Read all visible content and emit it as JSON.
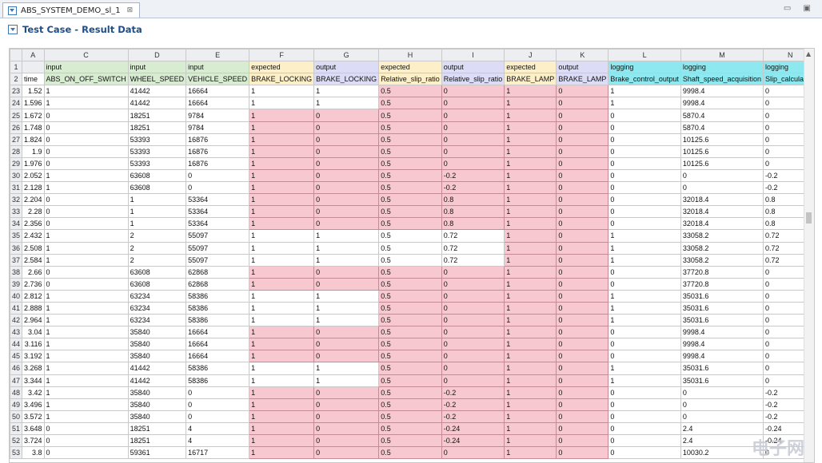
{
  "tab": {
    "title": "ABS_SYSTEM_DEMO_sl_1",
    "close": "⊠"
  },
  "window_controls": "▭ ▣",
  "header": {
    "title": "Test Case - Result Data"
  },
  "columns": [
    "A",
    "C",
    "D",
    "E",
    "F",
    "G",
    "H",
    "I",
    "J",
    "K",
    "L",
    "M",
    "N"
  ],
  "col_widths": [
    40,
    77,
    77,
    77,
    77,
    77,
    77,
    77,
    77,
    77,
    77,
    77,
    77,
    56
  ],
  "row1": [
    "",
    "input",
    "input",
    "input",
    "expected",
    "output",
    "expected",
    "output",
    "expected",
    "output",
    "logging",
    "logging",
    "logging"
  ],
  "row2": [
    "time",
    "ABS_ON_OFF_SWITCH",
    "WHEEL_SPEED",
    "VEHICLE_SPEED",
    "BRAKE_LOCKING",
    "BRAKE_LOCKING",
    "Relative_slip_ratio",
    "Relative_slip_ratio",
    "BRAKE_LAMP",
    "BRAKE_LAMP",
    "Brake_control_output",
    "Shaft_speed_acquisition",
    "Slip_calculation"
  ],
  "row1_colors": [
    "#ffffff",
    "#d7ecd1",
    "#d7ecd1",
    "#d7ecd1",
    "#fdf0c9",
    "#dcdcf6",
    "#fdf0c9",
    "#dcdcf6",
    "#fdf0c9",
    "#dcdcf6",
    "#8de9ef",
    "#8de9ef",
    "#8de9ef"
  ],
  "rows": [
    {
      "n": "23",
      "v": [
        "1.52",
        "1",
        "41442",
        "16664",
        "1",
        "1",
        "0.5",
        "0",
        "1",
        "0",
        "1",
        "9998.4",
        "0"
      ],
      "p": [
        0,
        0,
        0,
        0,
        0,
        0,
        1,
        1,
        1,
        1,
        0,
        0,
        0
      ]
    },
    {
      "n": "24",
      "v": [
        "1.596",
        "1",
        "41442",
        "16664",
        "1",
        "1",
        "0.5",
        "0",
        "1",
        "0",
        "1",
        "9998.4",
        "0"
      ],
      "p": [
        0,
        0,
        0,
        0,
        0,
        0,
        1,
        1,
        1,
        1,
        0,
        0,
        0
      ]
    },
    {
      "n": "25",
      "v": [
        "1.672",
        "0",
        "18251",
        "9784",
        "1",
        "0",
        "0.5",
        "0",
        "1",
        "0",
        "0",
        "5870.4",
        "0"
      ],
      "p": [
        0,
        0,
        0,
        0,
        1,
        1,
        1,
        1,
        1,
        1,
        0,
        0,
        0
      ]
    },
    {
      "n": "26",
      "v": [
        "1.748",
        "0",
        "18251",
        "9784",
        "1",
        "0",
        "0.5",
        "0",
        "1",
        "0",
        "0",
        "5870.4",
        "0"
      ],
      "p": [
        0,
        0,
        0,
        0,
        1,
        1,
        1,
        1,
        1,
        1,
        0,
        0,
        0
      ]
    },
    {
      "n": "27",
      "v": [
        "1.824",
        "0",
        "53393",
        "16876",
        "1",
        "0",
        "0.5",
        "0",
        "1",
        "0",
        "0",
        "10125.6",
        "0"
      ],
      "p": [
        0,
        0,
        0,
        0,
        1,
        1,
        1,
        1,
        1,
        1,
        0,
        0,
        0
      ]
    },
    {
      "n": "28",
      "v": [
        "1.9",
        "0",
        "53393",
        "16876",
        "1",
        "0",
        "0.5",
        "0",
        "1",
        "0",
        "0",
        "10125.6",
        "0"
      ],
      "p": [
        0,
        0,
        0,
        0,
        1,
        1,
        1,
        1,
        1,
        1,
        0,
        0,
        0
      ]
    },
    {
      "n": "29",
      "v": [
        "1.976",
        "0",
        "53393",
        "16876",
        "1",
        "0",
        "0.5",
        "0",
        "1",
        "0",
        "0",
        "10125.6",
        "0"
      ],
      "p": [
        0,
        0,
        0,
        0,
        1,
        1,
        1,
        1,
        1,
        1,
        0,
        0,
        0
      ]
    },
    {
      "n": "30",
      "v": [
        "2.052",
        "1",
        "63608",
        "0",
        "1",
        "0",
        "0.5",
        "-0.2",
        "1",
        "0",
        "0",
        "0",
        "-0.2"
      ],
      "p": [
        0,
        0,
        0,
        0,
        1,
        1,
        1,
        1,
        1,
        1,
        0,
        0,
        0
      ]
    },
    {
      "n": "31",
      "v": [
        "2.128",
        "1",
        "63608",
        "0",
        "1",
        "0",
        "0.5",
        "-0.2",
        "1",
        "0",
        "0",
        "0",
        "-0.2"
      ],
      "p": [
        0,
        0,
        0,
        0,
        1,
        1,
        1,
        1,
        1,
        1,
        0,
        0,
        0
      ]
    },
    {
      "n": "32",
      "v": [
        "2.204",
        "0",
        "1",
        "53364",
        "1",
        "0",
        "0.5",
        "0.8",
        "1",
        "0",
        "0",
        "32018.4",
        "0.8"
      ],
      "p": [
        0,
        0,
        0,
        0,
        1,
        1,
        1,
        1,
        1,
        1,
        0,
        0,
        0
      ]
    },
    {
      "n": "33",
      "v": [
        "2.28",
        "0",
        "1",
        "53364",
        "1",
        "0",
        "0.5",
        "0.8",
        "1",
        "0",
        "0",
        "32018.4",
        "0.8"
      ],
      "p": [
        0,
        0,
        0,
        0,
        1,
        1,
        1,
        1,
        1,
        1,
        0,
        0,
        0
      ]
    },
    {
      "n": "34",
      "v": [
        "2.356",
        "0",
        "1",
        "53364",
        "1",
        "0",
        "0.5",
        "0.8",
        "1",
        "0",
        "0",
        "32018.4",
        "0.8"
      ],
      "p": [
        0,
        0,
        0,
        0,
        1,
        1,
        1,
        1,
        1,
        1,
        0,
        0,
        0
      ]
    },
    {
      "n": "35",
      "v": [
        "2.432",
        "1",
        "2",
        "55097",
        "1",
        "1",
        "0.5",
        "0.72",
        "1",
        "0",
        "1",
        "33058.2",
        "0.72"
      ],
      "p": [
        0,
        0,
        0,
        0,
        0,
        0,
        0,
        0,
        1,
        1,
        0,
        0,
        0
      ]
    },
    {
      "n": "36",
      "v": [
        "2.508",
        "1",
        "2",
        "55097",
        "1",
        "1",
        "0.5",
        "0.72",
        "1",
        "0",
        "1",
        "33058.2",
        "0.72"
      ],
      "p": [
        0,
        0,
        0,
        0,
        0,
        0,
        0,
        0,
        1,
        1,
        0,
        0,
        0
      ]
    },
    {
      "n": "37",
      "v": [
        "2.584",
        "1",
        "2",
        "55097",
        "1",
        "1",
        "0.5",
        "0.72",
        "1",
        "0",
        "1",
        "33058.2",
        "0.72"
      ],
      "p": [
        0,
        0,
        0,
        0,
        0,
        0,
        0,
        0,
        1,
        1,
        0,
        0,
        0
      ]
    },
    {
      "n": "38",
      "v": [
        "2.66",
        "0",
        "63608",
        "62868",
        "1",
        "0",
        "0.5",
        "0",
        "1",
        "0",
        "0",
        "37720.8",
        "0"
      ],
      "p": [
        0,
        0,
        0,
        0,
        1,
        1,
        1,
        1,
        1,
        1,
        0,
        0,
        0
      ]
    },
    {
      "n": "39",
      "v": [
        "2.736",
        "0",
        "63608",
        "62868",
        "1",
        "0",
        "0.5",
        "0",
        "1",
        "0",
        "0",
        "37720.8",
        "0"
      ],
      "p": [
        0,
        0,
        0,
        0,
        1,
        1,
        1,
        1,
        1,
        1,
        0,
        0,
        0
      ]
    },
    {
      "n": "40",
      "v": [
        "2.812",
        "1",
        "63234",
        "58386",
        "1",
        "1",
        "0.5",
        "0",
        "1",
        "0",
        "1",
        "35031.6",
        "0"
      ],
      "p": [
        0,
        0,
        0,
        0,
        0,
        0,
        1,
        1,
        1,
        1,
        0,
        0,
        0
      ]
    },
    {
      "n": "41",
      "v": [
        "2.888",
        "1",
        "63234",
        "58386",
        "1",
        "1",
        "0.5",
        "0",
        "1",
        "0",
        "1",
        "35031.6",
        "0"
      ],
      "p": [
        0,
        0,
        0,
        0,
        0,
        0,
        1,
        1,
        1,
        1,
        0,
        0,
        0
      ]
    },
    {
      "n": "42",
      "v": [
        "2.964",
        "1",
        "63234",
        "58386",
        "1",
        "1",
        "0.5",
        "0",
        "1",
        "0",
        "1",
        "35031.6",
        "0"
      ],
      "p": [
        0,
        0,
        0,
        0,
        0,
        0,
        1,
        1,
        1,
        1,
        0,
        0,
        0
      ]
    },
    {
      "n": "43",
      "v": [
        "3.04",
        "1",
        "35840",
        "16664",
        "1",
        "0",
        "0.5",
        "0",
        "1",
        "0",
        "0",
        "9998.4",
        "0"
      ],
      "p": [
        0,
        0,
        0,
        0,
        1,
        1,
        1,
        1,
        1,
        1,
        0,
        0,
        0
      ]
    },
    {
      "n": "44",
      "v": [
        "3.116",
        "1",
        "35840",
        "16664",
        "1",
        "0",
        "0.5",
        "0",
        "1",
        "0",
        "0",
        "9998.4",
        "0"
      ],
      "p": [
        0,
        0,
        0,
        0,
        1,
        1,
        1,
        1,
        1,
        1,
        0,
        0,
        0
      ]
    },
    {
      "n": "45",
      "v": [
        "3.192",
        "1",
        "35840",
        "16664",
        "1",
        "0",
        "0.5",
        "0",
        "1",
        "0",
        "0",
        "9998.4",
        "0"
      ],
      "p": [
        0,
        0,
        0,
        0,
        1,
        1,
        1,
        1,
        1,
        1,
        0,
        0,
        0
      ]
    },
    {
      "n": "46",
      "v": [
        "3.268",
        "1",
        "41442",
        "58386",
        "1",
        "1",
        "0.5",
        "0",
        "1",
        "0",
        "1",
        "35031.6",
        "0"
      ],
      "p": [
        0,
        0,
        0,
        0,
        0,
        0,
        1,
        1,
        1,
        1,
        0,
        0,
        0
      ]
    },
    {
      "n": "47",
      "v": [
        "3.344",
        "1",
        "41442",
        "58386",
        "1",
        "1",
        "0.5",
        "0",
        "1",
        "0",
        "1",
        "35031.6",
        "0"
      ],
      "p": [
        0,
        0,
        0,
        0,
        0,
        0,
        1,
        1,
        1,
        1,
        0,
        0,
        0
      ]
    },
    {
      "n": "48",
      "v": [
        "3.42",
        "1",
        "35840",
        "0",
        "1",
        "0",
        "0.5",
        "-0.2",
        "1",
        "0",
        "0",
        "0",
        "-0.2"
      ],
      "p": [
        0,
        0,
        0,
        0,
        1,
        1,
        1,
        1,
        1,
        1,
        0,
        0,
        0
      ]
    },
    {
      "n": "49",
      "v": [
        "3.496",
        "1",
        "35840",
        "0",
        "1",
        "0",
        "0.5",
        "-0.2",
        "1",
        "0",
        "0",
        "0",
        "-0.2"
      ],
      "p": [
        0,
        0,
        0,
        0,
        1,
        1,
        1,
        1,
        1,
        1,
        0,
        0,
        0
      ]
    },
    {
      "n": "50",
      "v": [
        "3.572",
        "1",
        "35840",
        "0",
        "1",
        "0",
        "0.5",
        "-0.2",
        "1",
        "0",
        "0",
        "0",
        "-0.2"
      ],
      "p": [
        0,
        0,
        0,
        0,
        1,
        1,
        1,
        1,
        1,
        1,
        0,
        0,
        0
      ]
    },
    {
      "n": "51",
      "v": [
        "3.648",
        "0",
        "18251",
        "4",
        "1",
        "0",
        "0.5",
        "-0.24",
        "1",
        "0",
        "0",
        "2.4",
        "-0.24"
      ],
      "p": [
        0,
        0,
        0,
        0,
        1,
        1,
        1,
        1,
        1,
        1,
        0,
        0,
        0
      ]
    },
    {
      "n": "52",
      "v": [
        "3.724",
        "0",
        "18251",
        "4",
        "1",
        "0",
        "0.5",
        "-0.24",
        "1",
        "0",
        "0",
        "2.4",
        "-0.24"
      ],
      "p": [
        0,
        0,
        0,
        0,
        1,
        1,
        1,
        1,
        1,
        1,
        0,
        0,
        0
      ]
    },
    {
      "n": "53",
      "v": [
        "3.8",
        "0",
        "59361",
        "16717",
        "1",
        "0",
        "0.5",
        "0",
        "1",
        "0",
        "0",
        "10030.2",
        "0"
      ],
      "p": [
        0,
        0,
        0,
        0,
        1,
        1,
        1,
        1,
        1,
        1,
        0,
        0,
        0
      ]
    }
  ],
  "watermark": "电子网"
}
